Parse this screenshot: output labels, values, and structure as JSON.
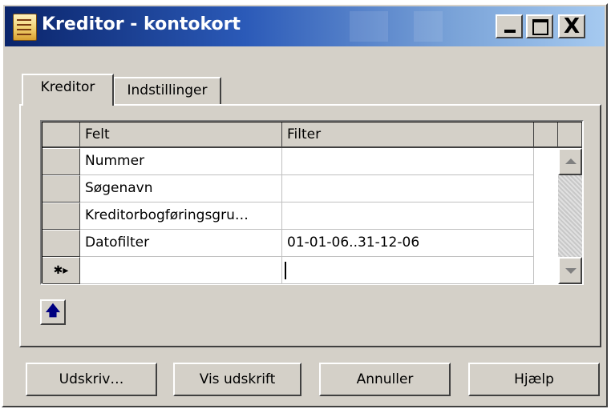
{
  "window": {
    "title": "Kreditor - kontokort"
  },
  "titlebar_buttons": {
    "minimize": "_",
    "maximize": "",
    "close": "X"
  },
  "tabs": [
    {
      "label": "Kreditor",
      "active": true
    },
    {
      "label": "Indstillinger",
      "active": false
    }
  ],
  "grid": {
    "columns": [
      "Felt",
      "Filter"
    ],
    "rows": [
      {
        "felt": "Nummer",
        "filter": ""
      },
      {
        "felt": "Søgenavn",
        "filter": ""
      },
      {
        "felt": "Kreditorbogføringsgru…",
        "filter": ""
      },
      {
        "felt": "Datofilter",
        "filter": "01-01-06..31-12-06"
      }
    ],
    "new_row_marker": "✱▸"
  },
  "icons": {
    "up_arrow": "arrow-up-icon"
  },
  "buttons": {
    "print": "Udskriv…",
    "preview": "Vis udskrift",
    "cancel": "Annuller",
    "help": "Hjælp"
  }
}
